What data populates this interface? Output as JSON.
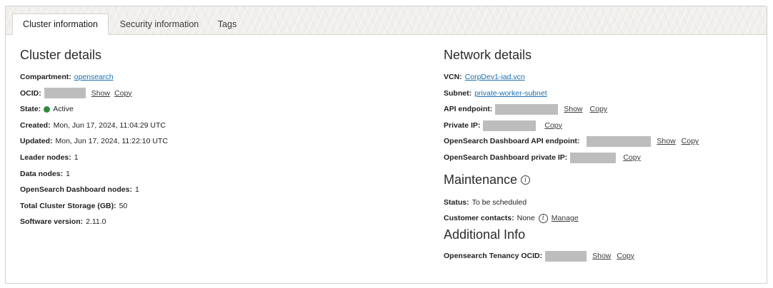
{
  "tabs": [
    {
      "label": "Cluster information"
    },
    {
      "label": "Security information"
    },
    {
      "label": "Tags"
    }
  ],
  "cluster": {
    "title": "Cluster details",
    "compartment_label": "Compartment:",
    "compartment_value": "opensearch",
    "ocid_label": "OCID:",
    "state_label": "State:",
    "state_value": "Active",
    "created_label": "Created:",
    "created_value": "Mon, Jun 17, 2024, 11:04:29 UTC",
    "updated_label": "Updated:",
    "updated_value": "Mon, Jun 17, 2024, 11:22:10 UTC",
    "leader_label": "Leader nodes:",
    "leader_value": "1",
    "data_label": "Data nodes:",
    "data_value": "1",
    "dashboard_nodes_label": "OpenSearch Dashboard nodes:",
    "dashboard_nodes_value": "1",
    "storage_label": "Total Cluster Storage (GB):",
    "storage_value": "50",
    "version_label": "Software version:",
    "version_value": "2.11.0"
  },
  "network": {
    "title": "Network details",
    "vcn_label": "VCN:",
    "vcn_value": "CorpDev1-iad.vcn",
    "subnet_label": "Subnet:",
    "subnet_value": "private-worker-subnet",
    "api_label": "API endpoint:",
    "private_ip_label": "Private IP:",
    "dash_api_label": "OpenSearch Dashboard API endpoint:",
    "dash_ip_label": "OpenSearch Dashboard private IP:"
  },
  "maintenance": {
    "title": "Maintenance",
    "status_label": "Status:",
    "status_value": "To be scheduled",
    "contacts_label": "Customer contacts:",
    "contacts_value": "None",
    "manage": "Manage"
  },
  "additional": {
    "title": "Additional Info",
    "tenancy_label": "Opensearch Tenancy OCID:"
  },
  "actions": {
    "show": "Show",
    "copy": "Copy"
  },
  "colors": {
    "link": "#1a6fb3",
    "active_state": "#2e8b3d",
    "redaction": "#bdbdbd"
  }
}
